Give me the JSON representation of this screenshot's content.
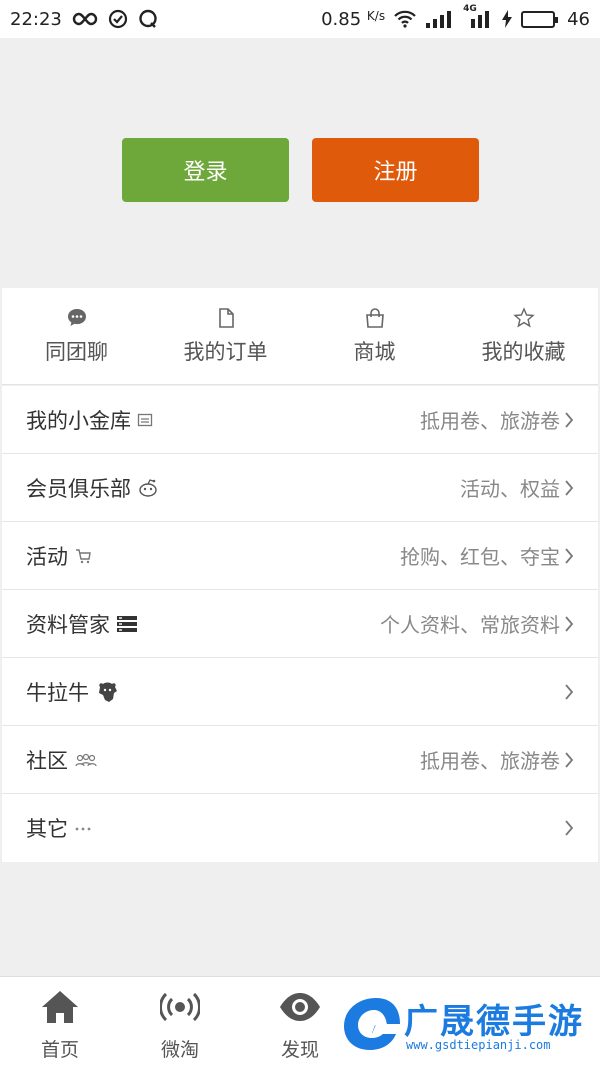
{
  "status_bar": {
    "time": "22:23",
    "speed": "0.85",
    "speed_unit": "K/s",
    "network": "4G",
    "battery": "46"
  },
  "auth": {
    "login_label": "登录",
    "register_label": "注册"
  },
  "quick_menu": [
    {
      "label": "同团聊",
      "icon": "chat-bubble-icon"
    },
    {
      "label": "我的订单",
      "icon": "document-icon"
    },
    {
      "label": "商城",
      "icon": "shopping-bag-icon"
    },
    {
      "label": "我的收藏",
      "icon": "star-icon"
    }
  ],
  "list": [
    {
      "title": "我的小金库",
      "subtitle": "抵用卷、旅游卷",
      "icon": "wallet-icon"
    },
    {
      "title": "会员俱乐部",
      "subtitle": "活动、权益",
      "icon": "club-icon"
    },
    {
      "title": "活动",
      "subtitle": "抢购、红包、夺宝",
      "icon": "cart-icon"
    },
    {
      "title": "资料管家",
      "subtitle": "个人资料、常旅资料",
      "icon": "stack-icon"
    },
    {
      "title": "牛拉牛",
      "subtitle": "",
      "icon": "bull-icon"
    },
    {
      "title": "社区",
      "subtitle": "抵用卷、旅游卷",
      "icon": "community-icon"
    },
    {
      "title": "其它",
      "subtitle": "",
      "icon": "more-dots-icon"
    }
  ],
  "tabbar": [
    {
      "label": "首页",
      "icon": "home-icon"
    },
    {
      "label": "微淘",
      "icon": "broadcast-icon"
    },
    {
      "label": "发现",
      "icon": "eye-icon"
    }
  ],
  "watermark": {
    "text": "广晟德手游",
    "url": "www.gsdtiepianji.com"
  },
  "colors": {
    "login": "#6ea73a",
    "register": "#e05a0c",
    "watermark": "#1c7be0"
  }
}
